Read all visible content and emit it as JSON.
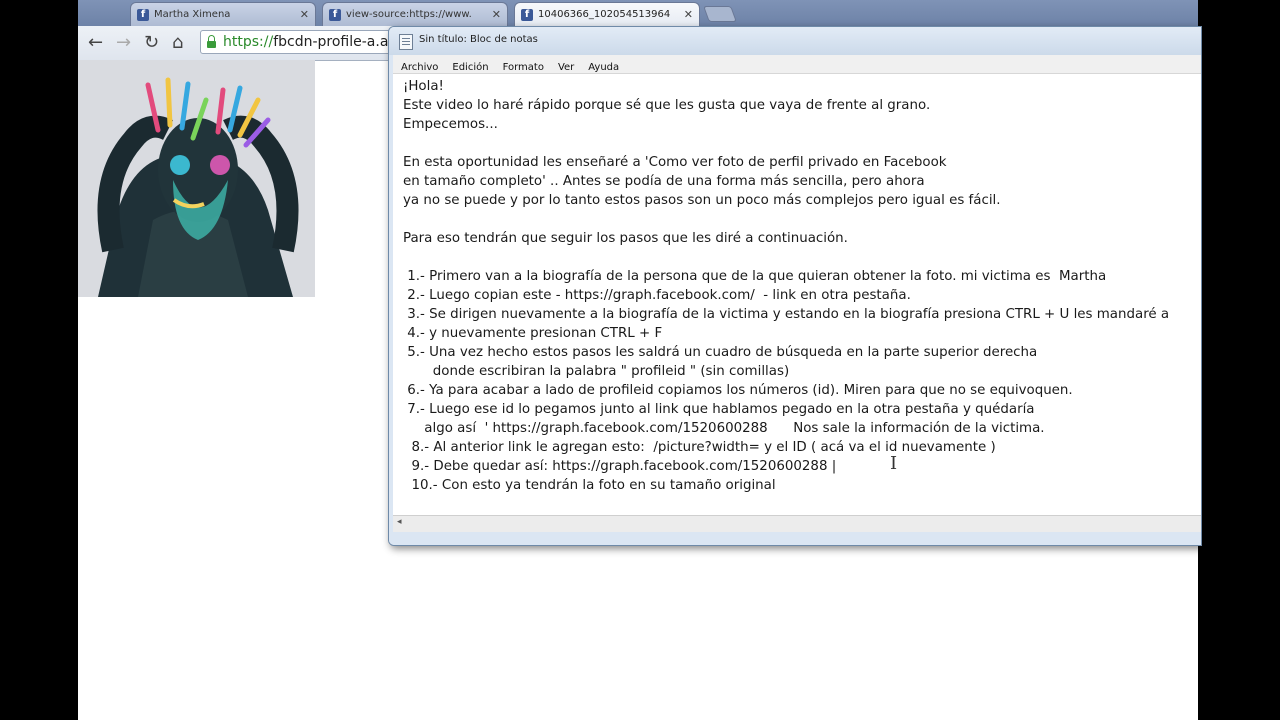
{
  "browser": {
    "tabs": [
      {
        "label": "Martha Ximena",
        "active": false
      },
      {
        "label": "view-source:https://www.",
        "active": false
      },
      {
        "label": "10406366_102054513964",
        "active": true
      }
    ],
    "url_scheme": "https://",
    "url_rest": "fbcdn-profile-a.a",
    "nav_icons": [
      "back-arrow-icon",
      "forward-arrow-icon",
      "reload-icon",
      "home-icon"
    ]
  },
  "notepad": {
    "title": "Sin título: Bloc de notas",
    "menu": [
      "Archivo",
      "Edición",
      "Formato",
      "Ver",
      "Ayuda"
    ],
    "lines": [
      "¡Hola!",
      "Este video lo haré rápido porque sé que les gusta que vaya de frente al grano.",
      "Empecemos...",
      "",
      "En esta oportunidad les enseñaré a 'Como ver foto de perfil privado en Facebook",
      "en tamaño completo' .. Antes se podía de una forma más sencilla, pero ahora",
      "ya no se puede y por lo tanto estos pasos son un poco más complejos pero igual es fácil.",
      "",
      "Para eso tendrán que seguir los pasos que les diré a continuación.",
      "",
      " 1.- Primero van a la biografía de la persona que de la que quieran obtener la foto. mi victima es  Martha",
      " 2.- Luego copian este - https://graph.facebook.com/  - link en otra pestaña.",
      " 3.- Se dirigen nuevamente a la biografía de la victima y estando en la biografía presiona CTRL + U les mandaré a",
      " 4.- y nuevamente presionan CTRL + F",
      " 5.- Una vez hecho estos pasos les saldrá un cuadro de búsqueda en la parte superior derecha",
      "       donde escribiran la palabra \" profileid \" (sin comillas)",
      " 6.- Ya para acabar a lado de profileid copiamos los números (id). Miren para que no se equivoquen.",
      " 7.- Luego ese id lo pegamos junto al link que hablamos pegado en la otra pestaña y quédaría",
      "     algo así  ' https://graph.facebook.com/1520600288      Nos sale la información de la victima.",
      "  8.- Al anterior link le agregan esto:  /picture?width= y el ID ( acá va el id nuevamente )",
      "  9.- Debe quedar así: https://graph.facebook.com/1520600288 |",
      "  10.- Con esto ya tendrán la foto en su tamaño original"
    ]
  },
  "colors": {
    "facebook_blue": "#3b5998",
    "tabstrip": "#7386aa",
    "notepad_frame": "#dbe6f3",
    "secure_green": "#2a8a2a"
  }
}
